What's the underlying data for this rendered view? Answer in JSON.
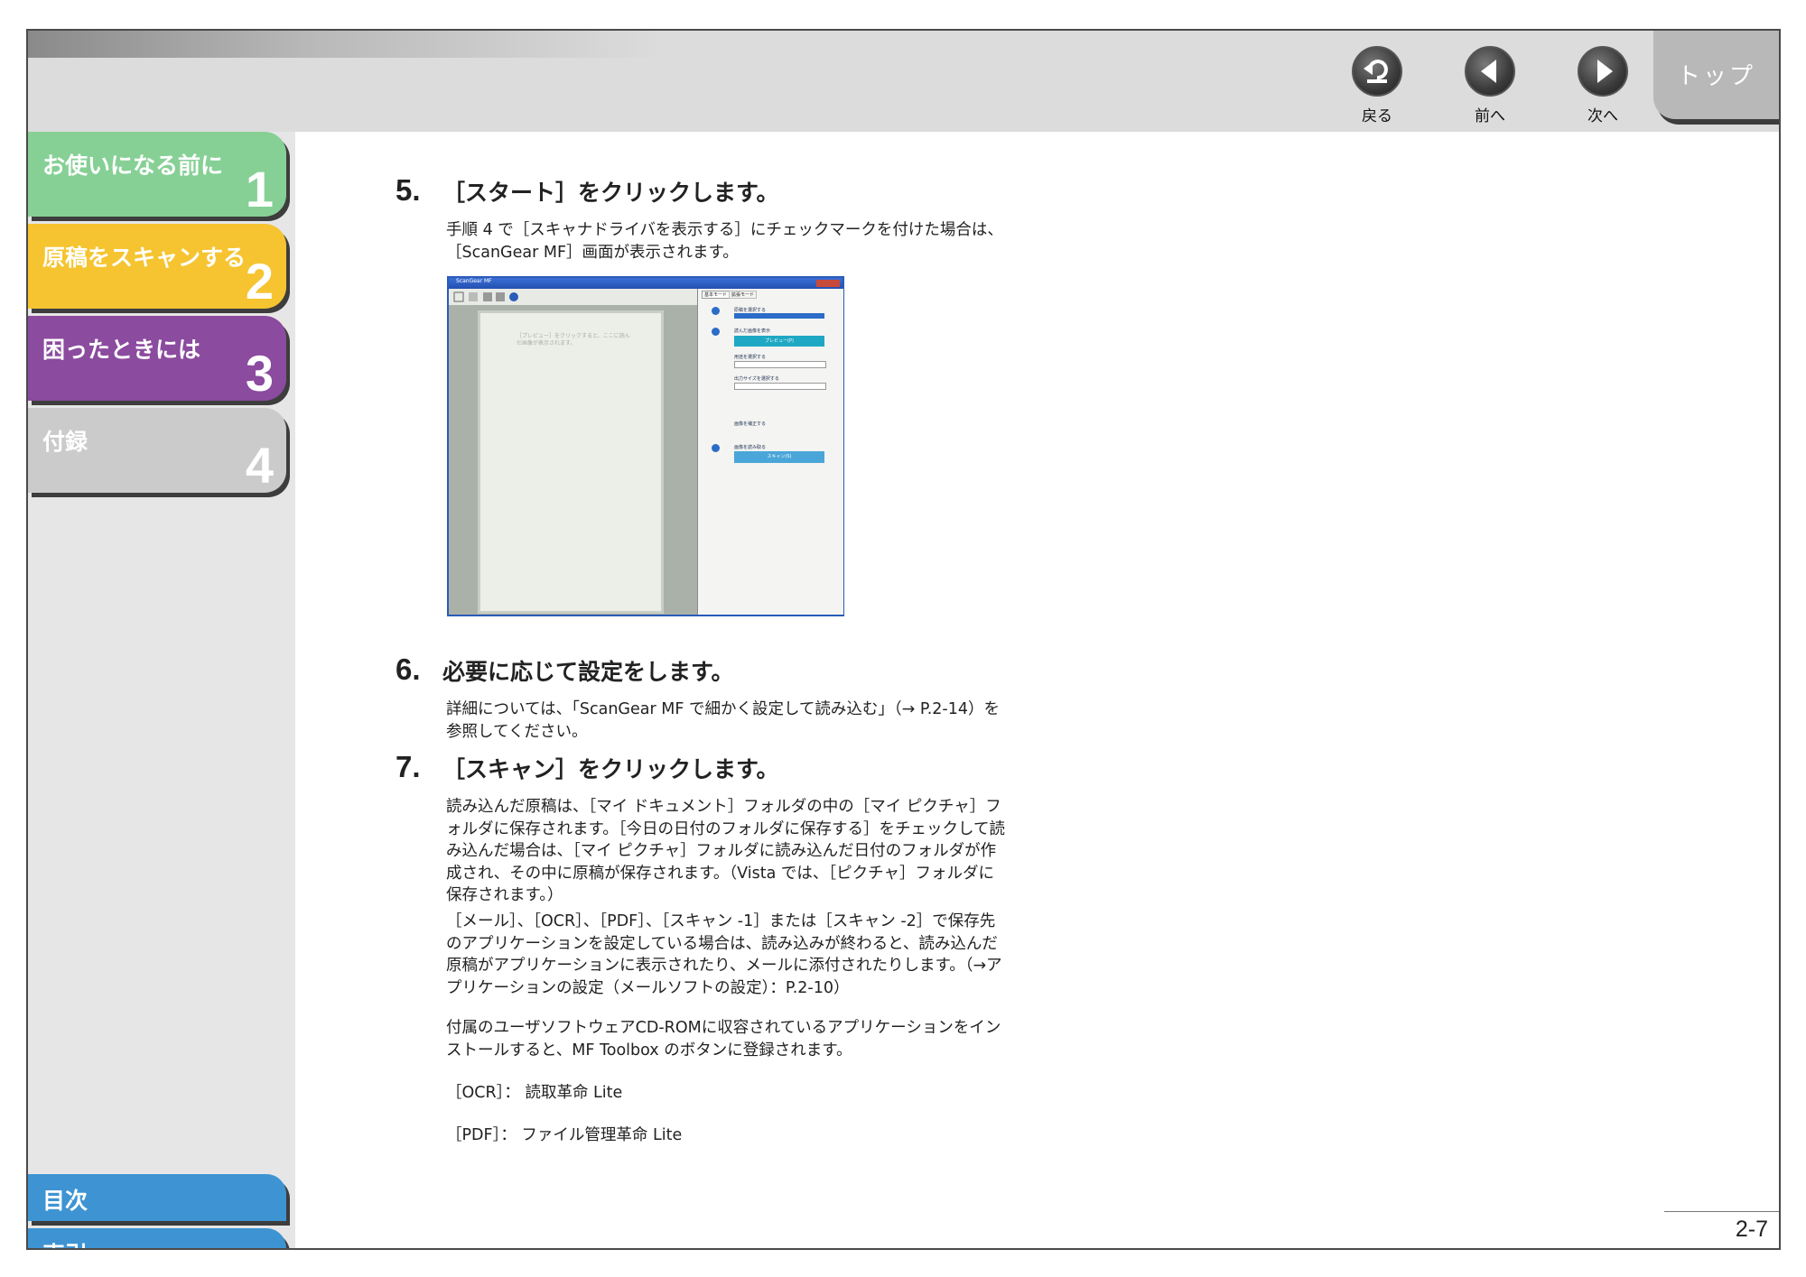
{
  "nav": {
    "back_label": "戻る",
    "prev_label": "前へ",
    "next_label": "次へ",
    "top_label": "トップ"
  },
  "sidebar": {
    "chapters": [
      {
        "title": "お使いになる前に",
        "number": "1",
        "color": "#7fcf8f"
      },
      {
        "title": "原稿をスキャンする",
        "number": "2",
        "color": "#f7c531"
      },
      {
        "title": "困ったときには",
        "number": "3",
        "color": "#8a4a9e"
      },
      {
        "title": "付録",
        "number": "4",
        "color": "#c8c8c8"
      }
    ],
    "toc_label": "目次",
    "index_label": "索引",
    "bottom_color": "#3f95d4"
  },
  "main": {
    "step5": {
      "number": "5.",
      "title": "［スタート］をクリックします。",
      "text": "手順 4 で［スキャナドライバを表示する］にチェックマークを付けた場合は、［ScanGear MF］画面が表示されます。"
    },
    "step6": {
      "number": "6.",
      "title": "必要に応じて設定をします。",
      "text": "詳細については、「ScanGear MF で細かく設定して読み込む」（→ P.2-14）を参照してください。"
    },
    "step7": {
      "number": "7.",
      "title": "［スキャン］をクリックします。",
      "p1": "読み込んだ原稿は、［マイ ドキュメント］フォルダの中の［マイ ピクチャ］フォルダに保存されます。［今日の日付のフォルダに保存する］をチェックして読み込んだ場合は、［マイ ピクチャ］フォルダに読み込んだ日付のフォルダが作成され、その中に原稿が保存されます。（Vista では、［ピクチャ］フォルダに保存されます。）",
      "p2": "［メール］、［OCR］、［PDF］、［スキャン -1］または［スキャン -2］で保存先のアプリケーションを設定している場合は、読み込みが終わると、読み込んだ原稿がアプリケーションに表示されたり、メールに添付されたりします。（→アプリケーションの設定（メールソフトの設定）：P.2-10）",
      "p3": "付属のユーザソフトウェアCD-ROMに収容されているアプリケーションをインストールすると、MF Toolbox のボタンに登録されます。",
      "ocr_line": "［OCR］：  読取革命 Lite",
      "pdf_line": "［PDF］：  ファイル管理革命 Lite"
    }
  },
  "screenshot": {
    "window_title": "ScanGear MF",
    "tab_basic": "基本モード",
    "tab_advanced": "拡張モード",
    "preview_hint": "［プレビュー］をクリックすると、ここに読んだ画像が表示されます。",
    "section1": "原稿を選択する",
    "section2": "読んだ画像を表示",
    "preview_button": "プレビュー(P)",
    "section3": "用途を選択する",
    "section4": "出力サイズを選択する",
    "section5": "画像を補正する",
    "section6": "画像を読み取る",
    "scan_button": "スキャン(S)"
  },
  "footer": {
    "page_number": "2-7"
  }
}
